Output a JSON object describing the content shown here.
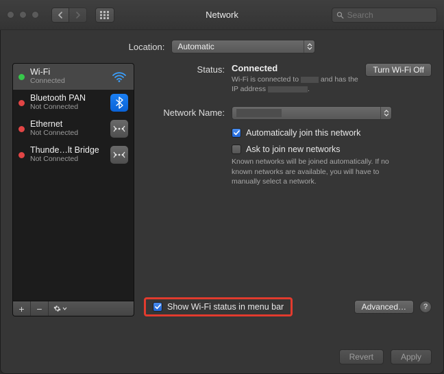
{
  "window": {
    "title": "Network"
  },
  "toolbar": {
    "search_placeholder": "Search"
  },
  "location": {
    "label": "Location:",
    "value": "Automatic"
  },
  "sidebar": {
    "items": [
      {
        "name": "Wi-Fi",
        "status": "Connected",
        "dot": "green",
        "icon": "wifi"
      },
      {
        "name": "Bluetooth PAN",
        "status": "Not Connected",
        "dot": "red",
        "icon": "bluetooth"
      },
      {
        "name": "Ethernet",
        "status": "Not Connected",
        "dot": "red",
        "icon": "ethernet"
      },
      {
        "name": "Thunde…lt Bridge",
        "status": "Not Connected",
        "dot": "red",
        "icon": "thunderbolt"
      }
    ],
    "toolbar": {
      "add": "+",
      "remove": "−",
      "actions": "✻▾"
    }
  },
  "detail": {
    "status_label": "Status:",
    "status_value": "Connected",
    "turn_off": "Turn Wi-Fi Off",
    "status_hint_a": "Wi-Fi is connected to",
    "status_hint_b": "and has the IP",
    "status_hint_c": "address",
    "network_name_label": "Network Name:",
    "network_name_value": "",
    "auto_join": "Automatically join this network",
    "ask_join": "Ask to join new networks",
    "ask_hint": "Known networks will be joined automatically. If no known networks are available, you will have to manually select a network.",
    "show_menu": "Show Wi-Fi status in menu bar",
    "advanced": "Advanced…",
    "help": "?"
  },
  "footer": {
    "revert": "Revert",
    "apply": "Apply"
  }
}
